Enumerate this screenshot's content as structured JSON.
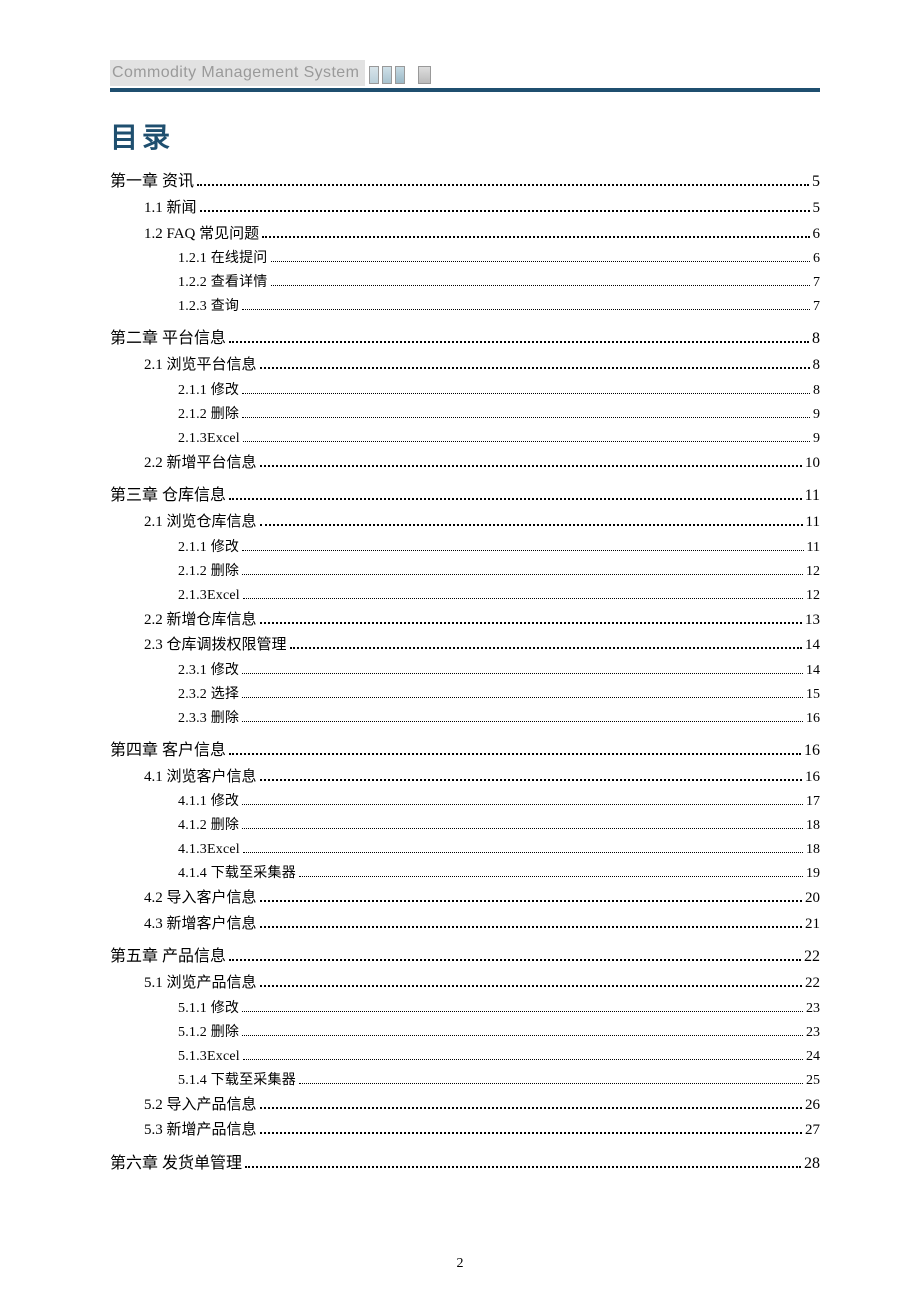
{
  "header": {
    "title": "Commodity Management System"
  },
  "toc_title": "目录",
  "page_number": "2",
  "entries": [
    {
      "level": 1,
      "label": "第一章 资讯",
      "page": "5"
    },
    {
      "level": 2,
      "label": "1.1 新闻",
      "page": "5"
    },
    {
      "level": 2,
      "label": "1.2 FAQ 常见问题",
      "page": "6"
    },
    {
      "level": 3,
      "label": "1.2.1 在线提问",
      "page": "6"
    },
    {
      "level": 3,
      "label": "1.2.2 查看详情",
      "page": "7"
    },
    {
      "level": 3,
      "label": "1.2.3 查询",
      "page": "7"
    },
    {
      "level": 1,
      "label": "第二章 平台信息",
      "page": "8"
    },
    {
      "level": 2,
      "label": "2.1 浏览平台信息",
      "page": "8"
    },
    {
      "level": 3,
      "label": "2.1.1 修改",
      "page": "8"
    },
    {
      "level": 3,
      "label": "2.1.2 删除",
      "page": "9"
    },
    {
      "level": 3,
      "label": "2.1.3Excel",
      "page": "9"
    },
    {
      "level": 2,
      "label": "2.2 新增平台信息",
      "page": "10"
    },
    {
      "level": 1,
      "label": "第三章 仓库信息",
      "page": "11"
    },
    {
      "level": 2,
      "label": "2.1 浏览仓库信息",
      "page": "11"
    },
    {
      "level": 3,
      "label": "2.1.1 修改",
      "page": "11"
    },
    {
      "level": 3,
      "label": "2.1.2 删除",
      "page": "12"
    },
    {
      "level": 3,
      "label": "2.1.3Excel",
      "page": "12"
    },
    {
      "level": 2,
      "label": "2.2 新增仓库信息",
      "page": "13"
    },
    {
      "level": 2,
      "label": "2.3 仓库调拨权限管理",
      "page": "14"
    },
    {
      "level": 3,
      "label": "2.3.1 修改",
      "page": "14"
    },
    {
      "level": 3,
      "label": "2.3.2 选择",
      "page": "15"
    },
    {
      "level": 3,
      "label": "2.3.3 删除",
      "page": "16"
    },
    {
      "level": 1,
      "label": "第四章 客户信息",
      "page": "16"
    },
    {
      "level": 2,
      "label": "4.1 浏览客户信息",
      "page": "16"
    },
    {
      "level": 3,
      "label": "4.1.1 修改",
      "page": "17"
    },
    {
      "level": 3,
      "label": "4.1.2 删除",
      "page": "18"
    },
    {
      "level": 3,
      "label": "4.1.3Excel",
      "page": "18"
    },
    {
      "level": 3,
      "label": "4.1.4 下载至采集器",
      "page": "19"
    },
    {
      "level": 2,
      "label": "4.2 导入客户信息",
      "page": "20"
    },
    {
      "level": 2,
      "label": "4.3 新增客户信息",
      "page": "21"
    },
    {
      "level": 1,
      "label": "第五章 产品信息",
      "page": "22"
    },
    {
      "level": 2,
      "label": "5.1 浏览产品信息",
      "page": "22"
    },
    {
      "level": 3,
      "label": "5.1.1 修改",
      "page": "23"
    },
    {
      "level": 3,
      "label": "5.1.2 删除",
      "page": "23"
    },
    {
      "level": 3,
      "label": "5.1.3Excel",
      "page": "24"
    },
    {
      "level": 3,
      "label": "5.1.4 下载至采集器",
      "page": "25"
    },
    {
      "level": 2,
      "label": "5.2 导入产品信息",
      "page": "26"
    },
    {
      "level": 2,
      "label": "5.3 新增产品信息",
      "page": "27"
    },
    {
      "level": 1,
      "label": "第六章 发货单管理",
      "page": "28"
    }
  ]
}
